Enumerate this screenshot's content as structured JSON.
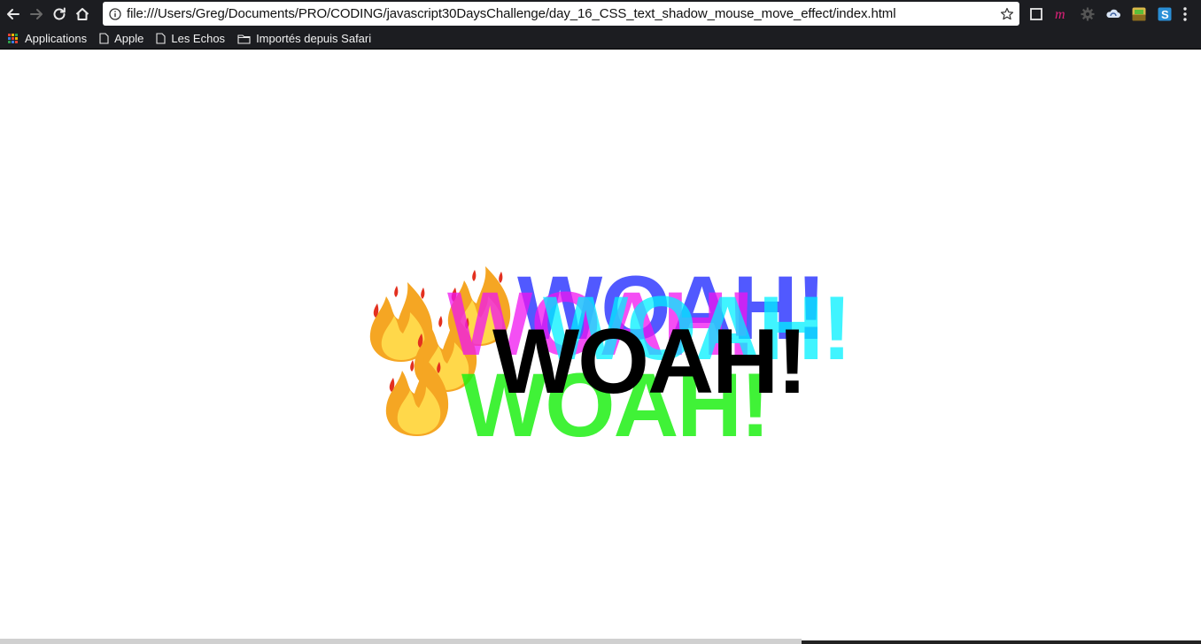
{
  "browser": {
    "url": "file:///Users/Greg/Documents/PRO/CODING/javascript30DaysChallenge/day_16_CSS_text_shadow_mouse_move_effect/index.html",
    "bookmarks": [
      {
        "label": "Applications",
        "icon": "apps-grid-icon"
      },
      {
        "label": "Apple",
        "icon": "page-icon"
      },
      {
        "label": "Les Echos",
        "icon": "page-icon"
      },
      {
        "label": "Importés depuis Safari",
        "icon": "folder-icon"
      }
    ],
    "colors": {
      "chrome": "#1c1d21"
    }
  },
  "page": {
    "heading": "WOAH!",
    "emoji": "🔥",
    "shadow_colors": {
      "blue": "#323cff",
      "magenta": "#f014f0",
      "cyan": "#00f0ff",
      "green": "#1ef014",
      "main": "#000000"
    }
  }
}
